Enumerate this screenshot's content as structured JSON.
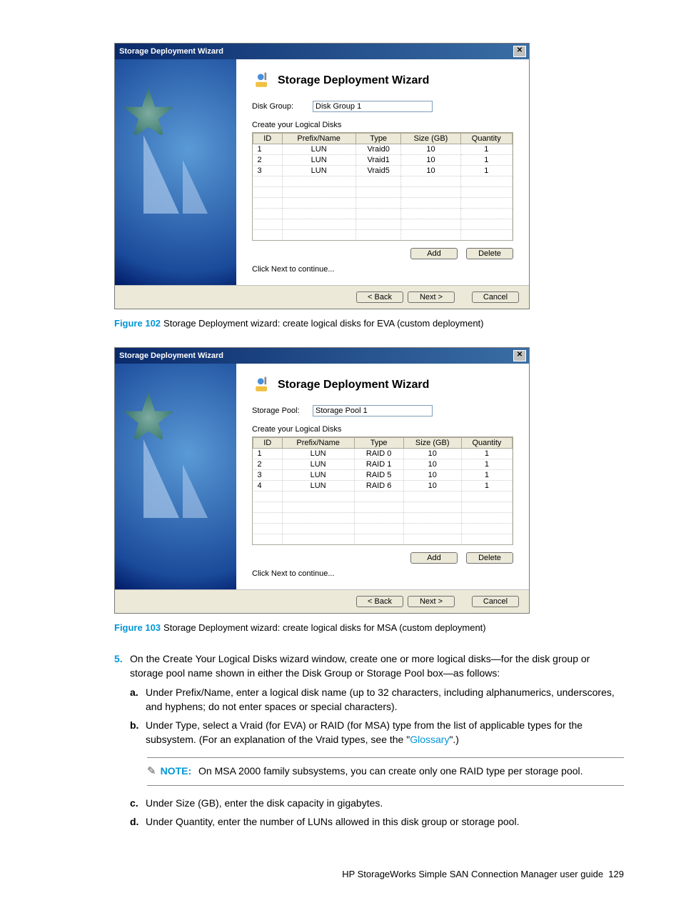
{
  "wizard1": {
    "window_title": "Storage Deployment Wizard",
    "heading": "Storage Deployment Wizard",
    "field_label": "Disk Group:",
    "field_value": "Disk Group 1",
    "section": "Create your Logical Disks",
    "cols": [
      "ID",
      "Prefix/Name",
      "Type",
      "Size (GB)",
      "Quantity"
    ],
    "rows": [
      [
        "1",
        "LUN",
        "Vraid0",
        "10",
        "1"
      ],
      [
        "2",
        "LUN",
        "Vraid1",
        "10",
        "1"
      ],
      [
        "3",
        "LUN",
        "Vraid5",
        "10",
        "1"
      ]
    ],
    "add": "Add",
    "delete": "Delete",
    "continue": "Click Next to continue...",
    "back": "< Back",
    "next": "Next >",
    "cancel": "Cancel"
  },
  "wizard2": {
    "window_title": "Storage Deployment Wizard",
    "heading": "Storage Deployment Wizard",
    "field_label": "Storage Pool:",
    "field_value": "Storage Pool 1",
    "section": "Create your Logical Disks",
    "cols": [
      "ID",
      "Prefix/Name",
      "Type",
      "Size (GB)",
      "Quantity"
    ],
    "rows": [
      [
        "1",
        "LUN",
        "RAID 0",
        "10",
        "1"
      ],
      [
        "2",
        "LUN",
        "RAID 1",
        "10",
        "1"
      ],
      [
        "3",
        "LUN",
        "RAID 5",
        "10",
        "1"
      ],
      [
        "4",
        "LUN",
        "RAID 6",
        "10",
        "1"
      ]
    ],
    "add": "Add",
    "delete": "Delete",
    "continue": "Click Next to continue...",
    "back": "< Back",
    "next": "Next >",
    "cancel": "Cancel"
  },
  "caption1": {
    "label": "Figure 102",
    "text": "Storage Deployment wizard: create logical disks for EVA (custom deployment)"
  },
  "caption2": {
    "label": "Figure 103",
    "text": "Storage Deployment wizard: create logical disks for MSA (custom deployment)"
  },
  "step5": {
    "num": "5.",
    "text": "On the Create Your Logical Disks wizard window, create one or more logical disks—for the disk group or storage pool name shown in either the Disk Group or Storage Pool box—as follows:",
    "a_let": "a.",
    "a": "Under Prefix/Name, enter a logical disk name (up to 32 characters, including alphanumerics, underscores, and hyphens; do not enter spaces or special characters).",
    "b_let": "b.",
    "b_pre": "Under Type, select a Vraid (for EVA) or RAID (for MSA) type from the list of applicable types for the subsystem. (For an explanation of the Vraid types, see the \"",
    "b_link": "Glossary",
    "b_post": "\".)",
    "c_let": "c.",
    "c": "Under Size (GB), enter the disk capacity in gigabytes.",
    "d_let": "d.",
    "d": "Under Quantity, enter the number of LUNs allowed in this disk group or storage pool."
  },
  "note": {
    "label": "NOTE:",
    "text": "On MSA 2000 family subsystems, you can create only one RAID type per storage pool."
  },
  "footer": {
    "text": "HP StorageWorks Simple SAN Connection Manager user guide",
    "page": "129"
  }
}
